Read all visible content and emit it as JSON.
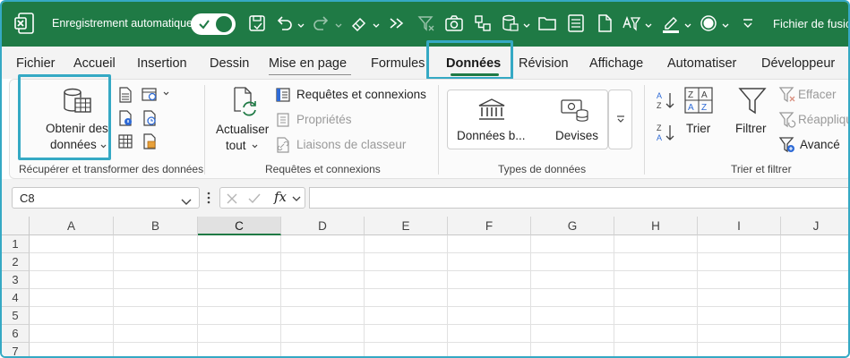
{
  "titlebar": {
    "autosave_label": "Enregistrement automatique",
    "document_title": "Fichier de fusion",
    "bg_color": "#1f7a45"
  },
  "tabs": [
    {
      "label": "Fichier"
    },
    {
      "label": "Accueil"
    },
    {
      "label": "Insertion"
    },
    {
      "label": "Dessin"
    },
    {
      "label": "Mise en page"
    },
    {
      "label": "Formules"
    },
    {
      "label": "Données",
      "active": true
    },
    {
      "label": "Révision"
    },
    {
      "label": "Affichage"
    },
    {
      "label": "Automatiser"
    },
    {
      "label": "Développeur"
    }
  ],
  "ribbon": {
    "get_data": {
      "line1": "Obtenir des",
      "line2": "données"
    },
    "refresh": {
      "line1": "Actualiser",
      "line2": "tout"
    },
    "queries": {
      "queries_connections": "Requêtes et connexions",
      "properties": "Propriétés",
      "workbook_links": "Liaisons de classeur"
    },
    "datatypes": {
      "stocks": "Données b...",
      "currencies": "Devises"
    },
    "sort": {
      "label": "Trier"
    },
    "filter": {
      "label": "Filtrer",
      "clear": "Effacer",
      "reapply": "Réappliquer",
      "advanced": "Avancé"
    },
    "groups": {
      "get_transform": "Récupérer et transformer des données",
      "queries_connections": "Requêtes et connexions",
      "data_types": "Types de données",
      "sort_filter": "Trier et filtrer"
    }
  },
  "formula_bar": {
    "name_box": "C8",
    "fx_label": "fx",
    "formula": ""
  },
  "grid": {
    "columns": [
      "A",
      "B",
      "C",
      "D",
      "E",
      "F",
      "G",
      "H",
      "I",
      "J"
    ],
    "selected_column": "C",
    "rows": [
      "1",
      "2",
      "3",
      "4",
      "5",
      "6",
      "7"
    ]
  },
  "colors": {
    "accent": "#1f7a45",
    "highlight": "#35a9c4"
  },
  "icons": {
    "excel_logo": "excel-logo-icon",
    "save": "save-icon",
    "undo": "undo-icon",
    "redo": "redo-icon",
    "eraser": "eraser-icon",
    "camera": "camera-icon"
  }
}
